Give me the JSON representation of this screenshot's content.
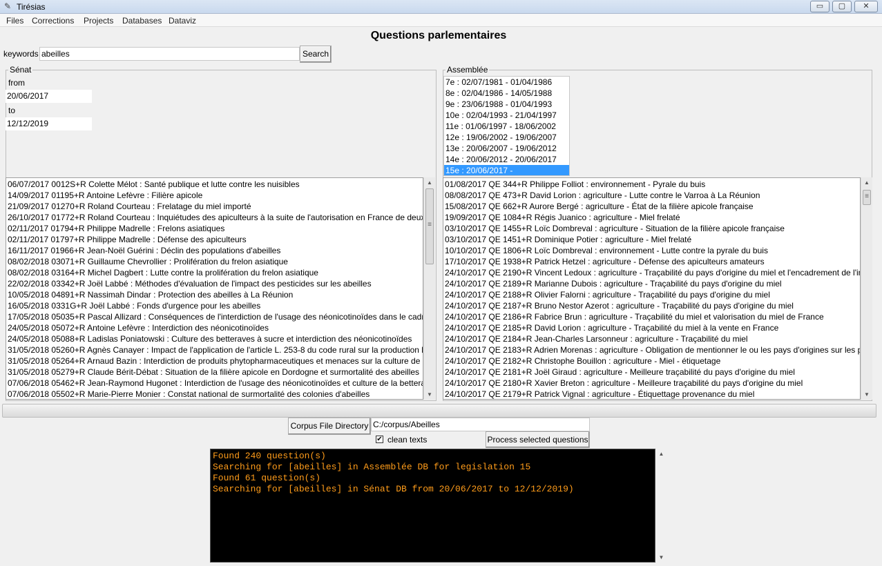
{
  "window": {
    "title": "Tirésias",
    "minimize_glyph": "▭",
    "maximize_glyph": "▢",
    "close_glyph": "✕",
    "app_icon": "quill-icon"
  },
  "menu": [
    "Files",
    "Corrections",
    "Projects",
    "Databases",
    "Dataviz"
  ],
  "heading": "Questions parlementaires",
  "search": {
    "label": "keywords",
    "value": "abeilles",
    "button": "Search"
  },
  "senat": {
    "frame_title": "Sénat",
    "from_label": "from",
    "from_value": "20/06/2017",
    "to_label": "to",
    "to_value": "12/12/2019",
    "results": [
      "06/07/2017 0012S+R   Colette Mélot : Santé publique et lutte contre les nuisibles",
      "14/09/2017 01195+R   Antoine Lefèvre : Filière apicole",
      "21/09/2017 01270+R   Roland Courteau : Frelatage du miel importé",
      "26/10/2017 01772+R   Roland Courteau : Inquiétudes des apiculteurs à la suite de l'autorisation en France de deux in",
      "02/11/2017 01794+R   Philippe Madrelle : Frelons asiatiques",
      "02/11/2017 01797+R   Philippe Madrelle : Défense des apiculteurs",
      "16/11/2017 01966+R   Jean-Noël Guérini : Déclin des populations d'abeilles",
      "08/02/2018 03071+R   Guillaume Chevrollier : Prolifération du frelon asiatique",
      "08/02/2018 03164+R   Michel Dagbert : Lutte contre la prolifération du frelon asiatique",
      "22/02/2018 03342+R   Joël Labbé : Méthodes d'évaluation de l'impact des pesticides sur les abeilles",
      "10/05/2018 04891+R   Nassimah Dindar : Protection des abeilles à La Réunion",
      "16/05/2018 0331G+R   Joël Labbé : Fonds d'urgence pour les abeilles",
      "17/05/2018 05035+R   Pascal Allizard : Conséquences de l'interdiction de l'usage des néonicotinoïdes dans le cadre",
      "24/05/2018 05072+R   Antoine Lefèvre : Interdiction des néonicotinoïdes",
      "24/05/2018 05088+R   Ladislas Poniatowski : Culture des betteraves à sucre et interdiction des néonicotinoïdes",
      "31/05/2018 05260+R   Agnès Canayer : Impact de l'application de l'article L. 253-8 du code rural sur la production b",
      "31/05/2018 05264+R   Arnaud Bazin : Interdiction de produits phytopharmaceutiques et menaces sur la culture de l",
      "31/05/2018 05279+R   Claude Bérit-Débat : Situation de la filière apicole en Dordogne et surmortalité des abeilles",
      "07/06/2018 05462+R   Jean-Raymond Hugonet : Interdiction de l'usage des néonicotinoïdes et culture de la bettera",
      "07/06/2018 05502+R   Marie-Pierre Monier : Constat national de surmortalité des colonies d'abeilles"
    ]
  },
  "assemblee": {
    "frame_title": "Assemblée",
    "legislatures": [
      "7e : 02/07/1981 - 01/04/1986",
      "8e : 02/04/1986 - 14/05/1988",
      "9e : 23/06/1988 - 01/04/1993",
      "10e : 02/04/1993 - 21/04/1997",
      "11e : 01/06/1997 - 18/06/2002",
      "12e : 19/06/2002 - 19/06/2007",
      "13e : 20/06/2007 - 19/06/2012",
      "14e : 20/06/2012 - 20/06/2017",
      "15e : 20/06/2017 -"
    ],
    "selected_legislature": "15e : 20/06/2017 -",
    "results": [
      "01/08/2017 QE 344+R   Philippe Folliot : environnement - Pyrale du buis",
      "08/08/2017 QE 473+R   David Lorion : agriculture - Lutte contre le Varroa à La Réunion",
      "15/08/2017 QE 662+R   Aurore Bergé : agriculture - État de la filière apicole française",
      "19/09/2017 QE 1084+R   Régis Juanico : agriculture - Miel frelaté",
      "03/10/2017 QE 1455+R   Loïc Dombreval : agriculture - Situation de la filière apicole française",
      "03/10/2017 QE 1451+R   Dominique Potier : agriculture - Miel frelaté",
      "10/10/2017 QE 1806+R   Loïc Dombreval : environnement - Lutte contre la pyrale du buis",
      "17/10/2017 QE 1938+R   Patrick Hetzel : agriculture - Défense des apiculteurs amateurs",
      "24/10/2017 QE 2190+R   Vincent Ledoux : agriculture - Traçabilité du pays d'origine du miel et l'encadrement de l'in",
      "24/10/2017 QE 2189+R   Marianne Dubois : agriculture - Traçabilité du pays d'origine du miel",
      "24/10/2017 QE 2188+R   Olivier Falorni : agriculture - Traçabilité du pays d'origine du miel",
      "24/10/2017 QE 2187+R   Bruno Nestor Azerot : agriculture - Traçabilité du pays d'origine du miel",
      "24/10/2017 QE 2186+R   Fabrice Brun : agriculture - Traçabilité du miel et valorisation du miel de France",
      "24/10/2017 QE 2185+R   David Lorion : agriculture - Traçabilité du miel à la vente en France",
      "24/10/2017 QE 2184+R   Jean-Charles Larsonneur : agriculture - Traçabilité du miel",
      "24/10/2017 QE 2183+R   Adrien Morenas : agriculture - Obligation de mentionner le ou les pays d'origines sur les p",
      "24/10/2017 QE 2182+R   Christophe Bouillon : agriculture - Miel - étiquetage",
      "24/10/2017 QE 2181+R   Joël Giraud : agriculture - Meilleure traçabilité du pays d'origine du miel",
      "24/10/2017 QE 2180+R   Xavier Breton : agriculture - Meilleure traçabilité du pays d'origine du miel",
      "24/10/2017 QE 2179+R   Patrick Vignal : agriculture - Étiquettage provenance du miel"
    ]
  },
  "corpus": {
    "button": "Corpus File Directory",
    "path": "C:/corpus/Abeilles",
    "clean_label": "clean texts",
    "clean_checked": true,
    "clean_glyph": "✔",
    "process_button": "Process selected questions"
  },
  "console": [
    "Found 240 question(s)",
    "Searching for [abeilles] in Assemblée DB for legislation 15",
    "Found 61 question(s)",
    "Searching for [abeilles] in Sénat DB from 20/06/2017 to 12/12/2019)"
  ],
  "scroll_arrows": {
    "up": "▲",
    "down": "▼",
    "grip": "≡"
  }
}
